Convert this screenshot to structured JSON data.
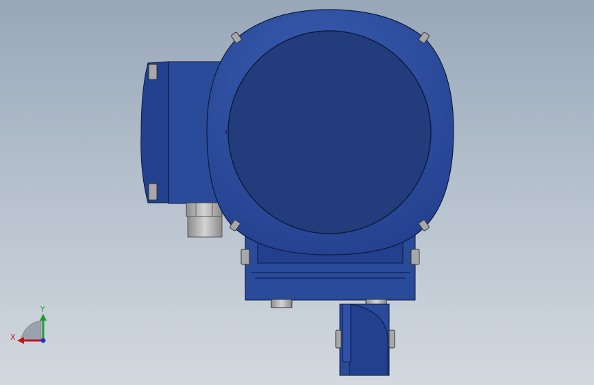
{
  "viewport": {
    "background_top": "#98a7b8",
    "background_bottom": "#d2d8de"
  },
  "model": {
    "body_color": "#2a4a9a",
    "face_color": "#223c7c",
    "edge_color": "#0c1a3c",
    "metal_color": "#b4b4b4"
  },
  "triad": {
    "x_label": "X",
    "y_label": "Y",
    "x_color": "#c0161b",
    "y_color": "#1a9e2a"
  }
}
